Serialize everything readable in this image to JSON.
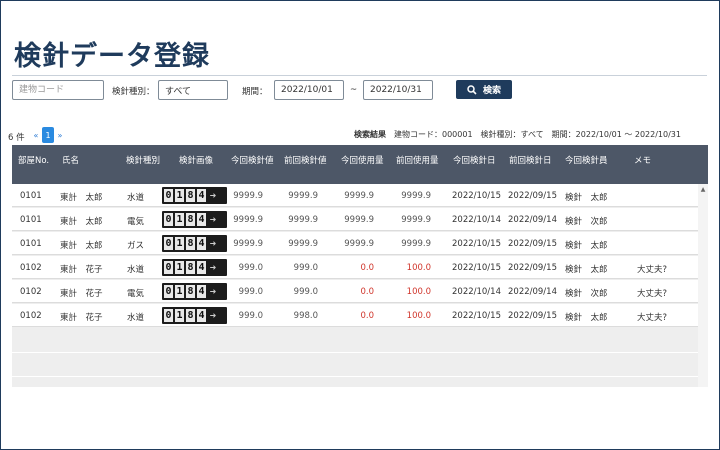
{
  "page": {
    "title": "検針データ登録"
  },
  "search": {
    "building_code_placeholder": "建物コード",
    "meter_type_label": "検針種別：",
    "meter_type_value": "すべて",
    "period_label": "期間：",
    "period_from": "2022/10/01",
    "period_sep": "~",
    "period_to": "2022/10/31",
    "search_button": "検索"
  },
  "pagination": {
    "count": "6 件",
    "prev": "«",
    "current": "1",
    "next": "»"
  },
  "result_info": {
    "heading": "検索結果",
    "building": "建物コード：000001",
    "meter_type": "検針種別：すべて",
    "period": "期間：2022/10/01 ～ 2022/10/31"
  },
  "table": {
    "headers": [
      "部屋No.",
      "氏名",
      "検針種別",
      "検針画像",
      "今回検針値",
      "前回検針値",
      "今回使用量",
      "前回使用量",
      "今回検針日",
      "前回検針日",
      "今回検針員",
      "メモ"
    ],
    "rows": [
      {
        "room": "0101",
        "name": "東計　太郎",
        "type": "水道",
        "meter": [
          "0",
          "1",
          "8",
          "4"
        ],
        "cur": "9999.9",
        "prev": "9999.9",
        "cur_use": "9999.9",
        "prev_use": "9999.9",
        "cur_date": "2022/10/15",
        "prev_date": "2022/09/15",
        "reader": "検針　太郎",
        "memo": "",
        "red": false
      },
      {
        "room": "0101",
        "name": "東計　太郎",
        "type": "電気",
        "meter": [
          "0",
          "1",
          "8",
          "4"
        ],
        "cur": "9999.9",
        "prev": "9999.9",
        "cur_use": "9999.9",
        "prev_use": "9999.9",
        "cur_date": "2022/10/14",
        "prev_date": "2022/09/14",
        "reader": "検針　次郎",
        "memo": "",
        "red": false
      },
      {
        "room": "0101",
        "name": "東計　太郎",
        "type": "ガス",
        "meter": [
          "0",
          "1",
          "8",
          "4"
        ],
        "cur": "9999.9",
        "prev": "9999.9",
        "cur_use": "9999.9",
        "prev_use": "9999.9",
        "cur_date": "2022/10/15",
        "prev_date": "2022/09/15",
        "reader": "検針　太郎",
        "memo": "",
        "red": false
      },
      {
        "room": "0102",
        "name": "東計　花子",
        "type": "水道",
        "meter": [
          "0",
          "1",
          "8",
          "4"
        ],
        "cur": "999.0",
        "prev": "999.0",
        "cur_use": "0.0",
        "prev_use": "100.0",
        "cur_date": "2022/10/15",
        "prev_date": "2022/09/15",
        "reader": "検針　太郎",
        "memo": "大丈夫?",
        "red": true
      },
      {
        "room": "0102",
        "name": "東計　花子",
        "type": "電気",
        "meter": [
          "0",
          "1",
          "8",
          "4"
        ],
        "cur": "999.0",
        "prev": "999.0",
        "cur_use": "0.0",
        "prev_use": "100.0",
        "cur_date": "2022/10/14",
        "prev_date": "2022/09/14",
        "reader": "検針　次郎",
        "memo": "大丈夫?",
        "red": true
      },
      {
        "room": "0102",
        "name": "東計　花子",
        "type": "水道",
        "meter": [
          "0",
          "1",
          "8",
          "4"
        ],
        "cur": "999.0",
        "prev": "998.0",
        "cur_use": "0.0",
        "prev_use": "100.0",
        "cur_date": "2022/10/15",
        "prev_date": "2022/09/15",
        "reader": "検針　太郎",
        "memo": "大丈夫?",
        "red": true
      }
    ]
  },
  "colors": {
    "header_bg": "#4d5767",
    "accent": "#1f3b5c",
    "alert": "#d0352b",
    "pager_active": "#2a8ae0"
  }
}
